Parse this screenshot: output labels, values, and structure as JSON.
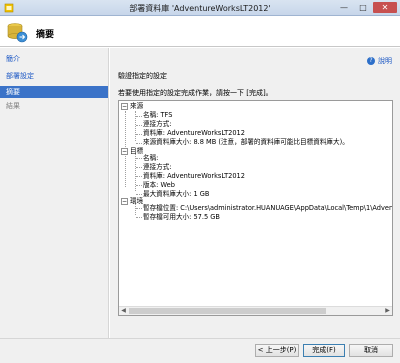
{
  "window": {
    "title": "部署資料庫 'AdventureWorksLT2012'",
    "min_glyph": "—",
    "max_glyph": "□",
    "close_glyph": "✕"
  },
  "header": {
    "title": "摘要"
  },
  "sidebar": {
    "items": [
      {
        "label": "簡介",
        "state": "link"
      },
      {
        "label": "部署設定",
        "state": "link"
      },
      {
        "label": "摘要",
        "state": "active"
      },
      {
        "label": "結果",
        "state": "disabled"
      }
    ]
  },
  "help": {
    "label": "說明"
  },
  "main": {
    "section_title": "驗證指定的設定",
    "description": "若要使用指定的設定完成作業，請按一下 [完成]。"
  },
  "tree": {
    "toggle_glyph": "−",
    "source": {
      "label": "來源",
      "items": [
        "名稱: TFS",
        "連接方式:",
        "資料庫: AdventureWorksLT2012",
        "來源資料庫大小: 8.8 MB (注意，部署的資料庫可能比目標資料庫大)。"
      ]
    },
    "target": {
      "label": "目標",
      "items": [
        "名稱:",
        "連接方式:",
        "資料庫: AdventureWorksLT2012",
        "版本: Web",
        "最大資料庫大小: 1 GB"
      ]
    },
    "env": {
      "label": "環境",
      "items": [
        "暫存檔位置: C:\\Users\\administrator.HUANUAGE\\AppData\\Local\\Temp\\1\\Advent",
        "暫存檔可用大小: 57.5 GB"
      ]
    },
    "scroll_left": "◀",
    "scroll_right": "▶"
  },
  "footer": {
    "prev_label": "< 上一步(P)",
    "finish_label": "完成(F)",
    "cancel_label": "取消"
  }
}
